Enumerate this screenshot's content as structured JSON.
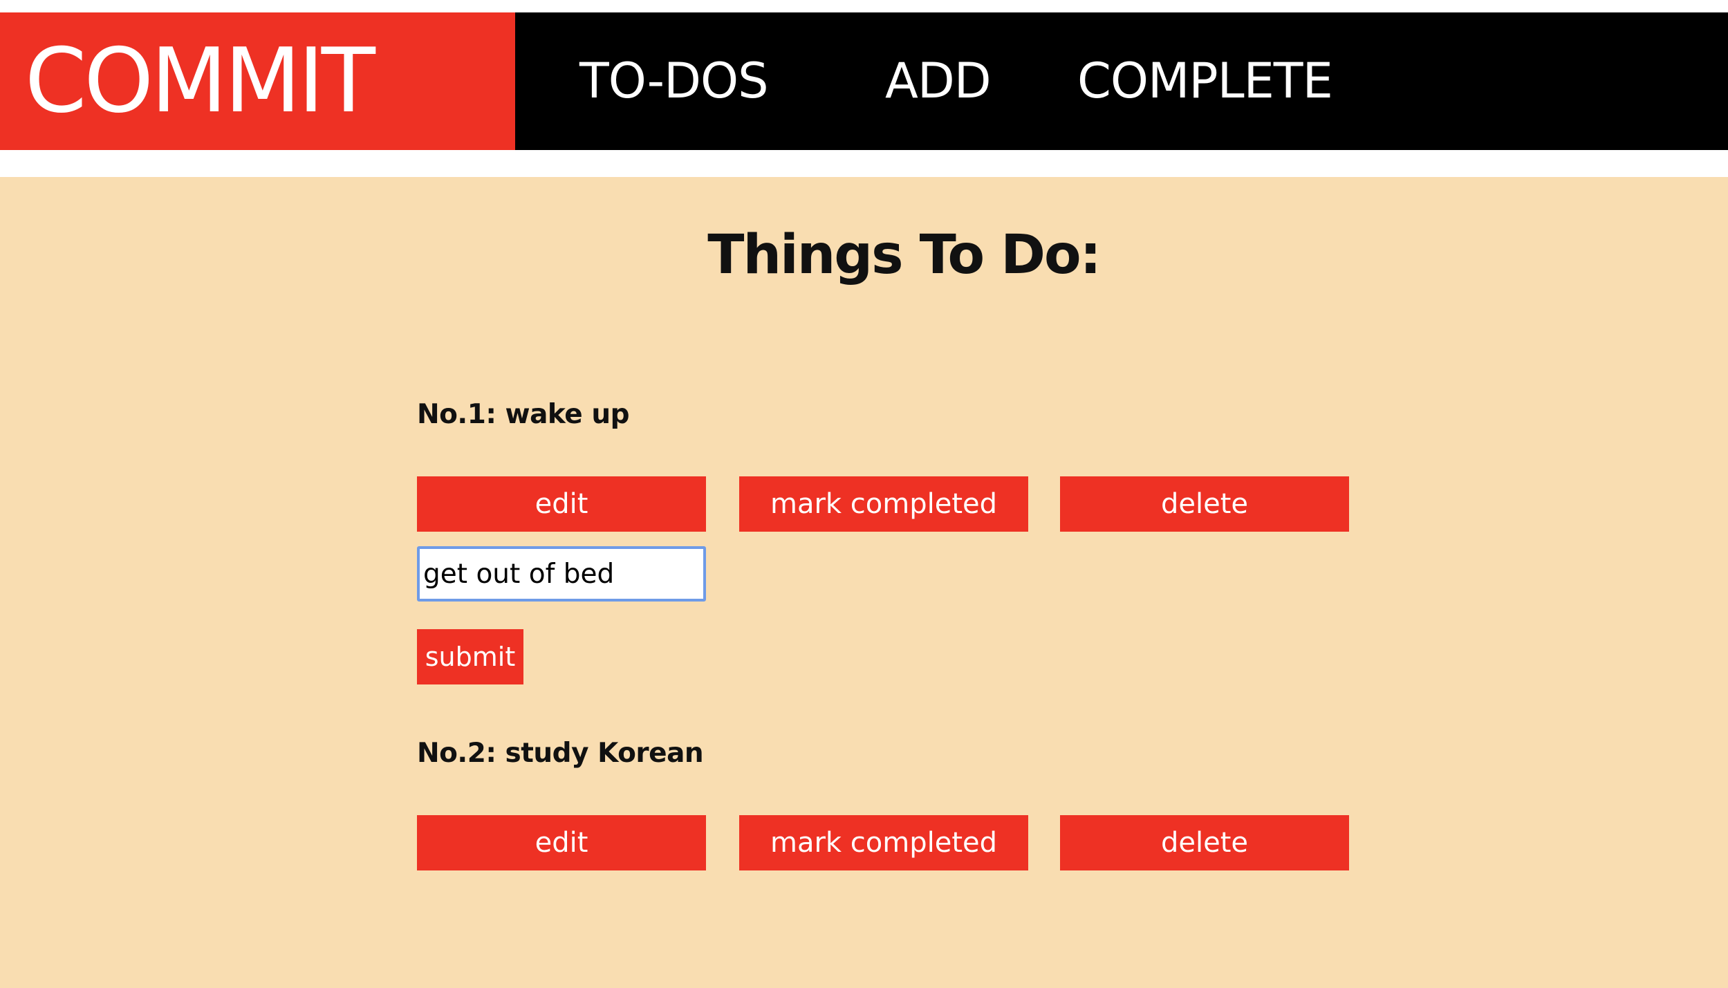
{
  "nav": {
    "brand": "COMMIT",
    "links": [
      {
        "label": "TO-DOS"
      },
      {
        "label": "ADD"
      },
      {
        "label": "COMPLETE"
      }
    ]
  },
  "main": {
    "title": "Things To Do:",
    "todos": [
      {
        "label": "No.1: wake up",
        "edit_label": "edit",
        "complete_label": "mark completed",
        "delete_label": "delete",
        "edit_value": "get out of bed",
        "submit_label": "submit"
      },
      {
        "label": "No.2: study Korean",
        "edit_label": "edit",
        "complete_label": "mark completed",
        "delete_label": "delete"
      }
    ]
  },
  "colors": {
    "accent": "#ee3124",
    "nav_background": "#000000",
    "page_background": "#f9ddb1",
    "input_focus_border": "#6f9be7"
  }
}
